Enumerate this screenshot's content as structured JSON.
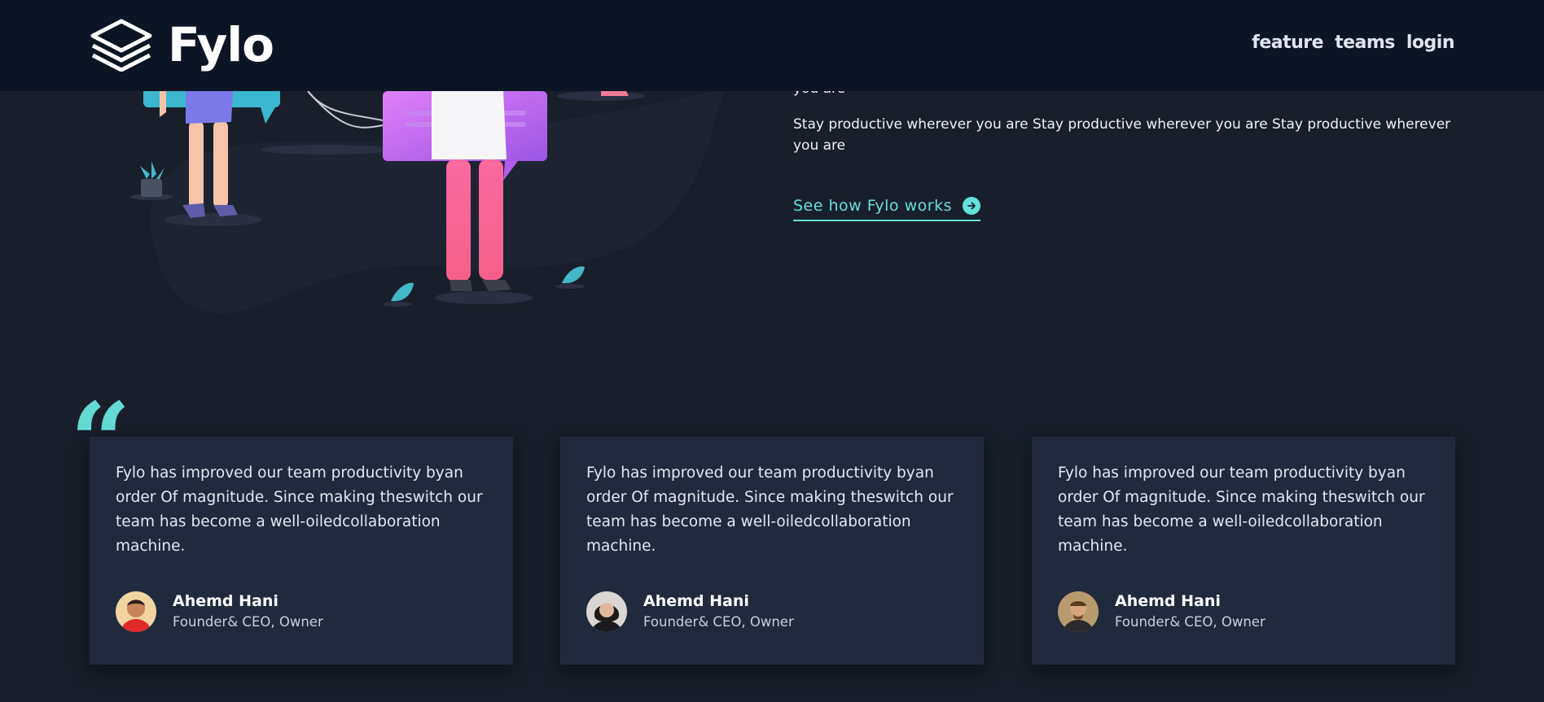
{
  "header": {
    "logo_text": "Fylo",
    "nav": [
      "feature",
      "teams",
      "login"
    ]
  },
  "intro": {
    "clipped_line": "you are",
    "paragraph": "Stay productive wherever you are Stay productive wherever you are Stay productive wherever you are",
    "cta_label": "See how Fylo works"
  },
  "testimonials": [
    {
      "quote": "Fylo has improved our team productivity byan order Of magnitude. Since making theswitch our team has become a well-oiledcollaboration machine.",
      "name": "Ahemd Hani",
      "role": "Founder& CEO, Owner"
    },
    {
      "quote": "Fylo has improved our team productivity byan order Of magnitude. Since making theswitch our team has become a well-oiledcollaboration machine.",
      "name": "Ahemd Hani",
      "role": "Founder& CEO, Owner"
    },
    {
      "quote": "Fylo has improved our team productivity byan order Of magnitude. Since making theswitch our team has become a well-oiledcollaboration machine.",
      "name": "Ahemd Hani",
      "role": "Founder& CEO, Owner"
    }
  ],
  "colors": {
    "accent": "#64e1d9",
    "background": "#181f2a",
    "header": "#0c1524",
    "card": "#212a3d"
  }
}
